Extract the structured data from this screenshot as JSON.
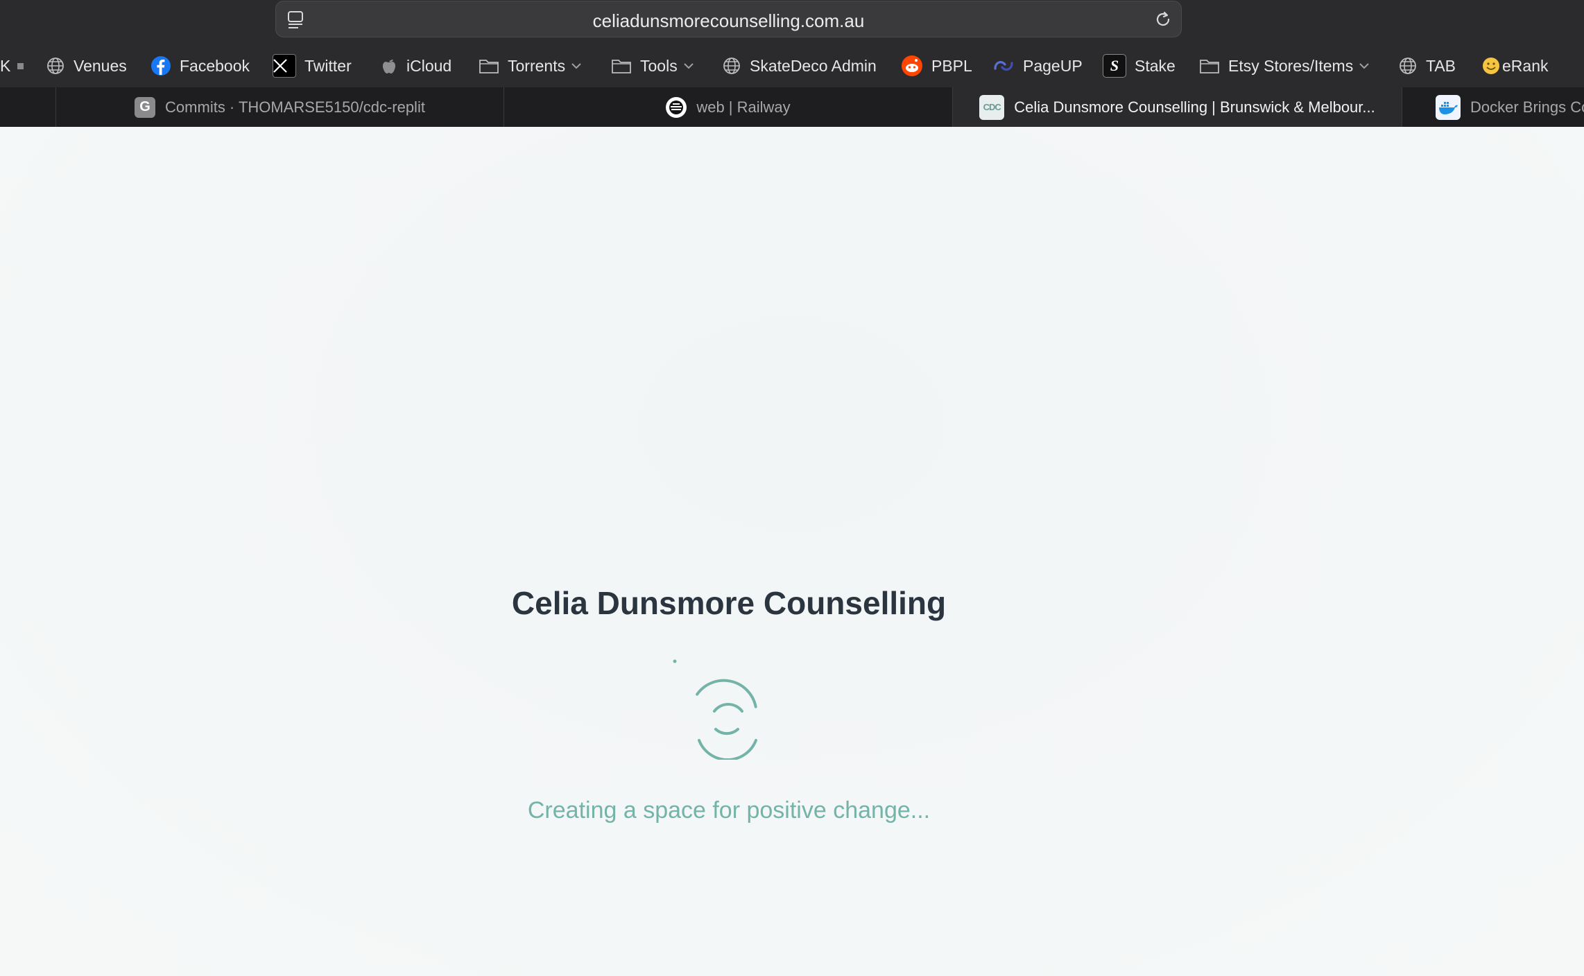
{
  "browser": {
    "url": "celiadunsmorecounselling.com.au",
    "bookmarks": [
      {
        "label": "K",
        "icon": "truncated-bookmark"
      },
      {
        "label": "Venues",
        "icon": "globe-icon"
      },
      {
        "label": "Facebook",
        "icon": "facebook-icon"
      },
      {
        "label": "Twitter",
        "icon": "x-icon"
      },
      {
        "label": "iCloud",
        "icon": "apple-icon"
      },
      {
        "label": "Torrents",
        "icon": "folder-icon"
      },
      {
        "label": "Tools",
        "icon": "folder-icon"
      },
      {
        "label": "SkateDeco Admin",
        "icon": "globe-icon"
      },
      {
        "label": "PBPL",
        "icon": "reddit-icon"
      },
      {
        "label": "PageUP",
        "icon": "pageup-icon"
      },
      {
        "label": "Stake",
        "icon": "stake-icon"
      },
      {
        "label": "Etsy Stores/Items",
        "icon": "folder-icon"
      },
      {
        "label": "TAB",
        "icon": "globe-icon"
      },
      {
        "label": "eRank",
        "icon": "smiley-icon"
      }
    ],
    "tabs": [
      {
        "label": "Commits · THOMARSE5150/cdc-replit",
        "favicon": "G"
      },
      {
        "label": "web | Railway",
        "favicon": "railway-icon"
      },
      {
        "label": "Celia Dunsmore Counselling | Brunswick & Melbour...",
        "favicon": "CDC",
        "active": true
      },
      {
        "label": "Docker Brings Co",
        "favicon": "docker-icon"
      }
    ]
  },
  "page": {
    "title": "Celia Dunsmore Counselling",
    "tagline": "Creating a space for positive change...",
    "accent_color": "#74b3a8",
    "title_color": "#2b3540"
  }
}
